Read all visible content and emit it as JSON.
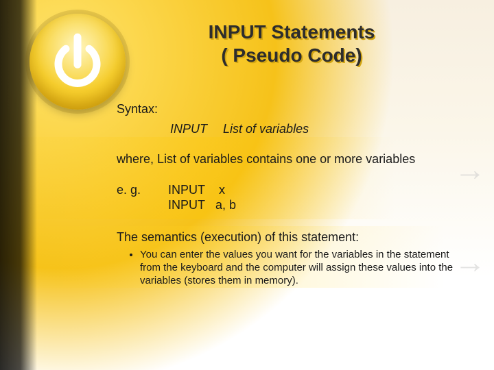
{
  "title_line1": "INPUT Statements",
  "title_line2": "( Pseudo Code)",
  "syntax_label": "Syntax:",
  "syntax_keyword": "INPUT",
  "syntax_args": "List of variables",
  "where_text": "where, List of variables contains one or more variables",
  "eg_label": "e. g.",
  "examples": [
    {
      "kw": "INPUT",
      "args": "x"
    },
    {
      "kw": "INPUT",
      "args": "a, b"
    }
  ],
  "semantics_heading": "The semantics (execution) of this statement:",
  "semantics_bullet": "You can enter the values you want for the variables in the statement from the keyboard and the computer will assign these values into the variables (stores them in memory).",
  "icon": "power-icon"
}
